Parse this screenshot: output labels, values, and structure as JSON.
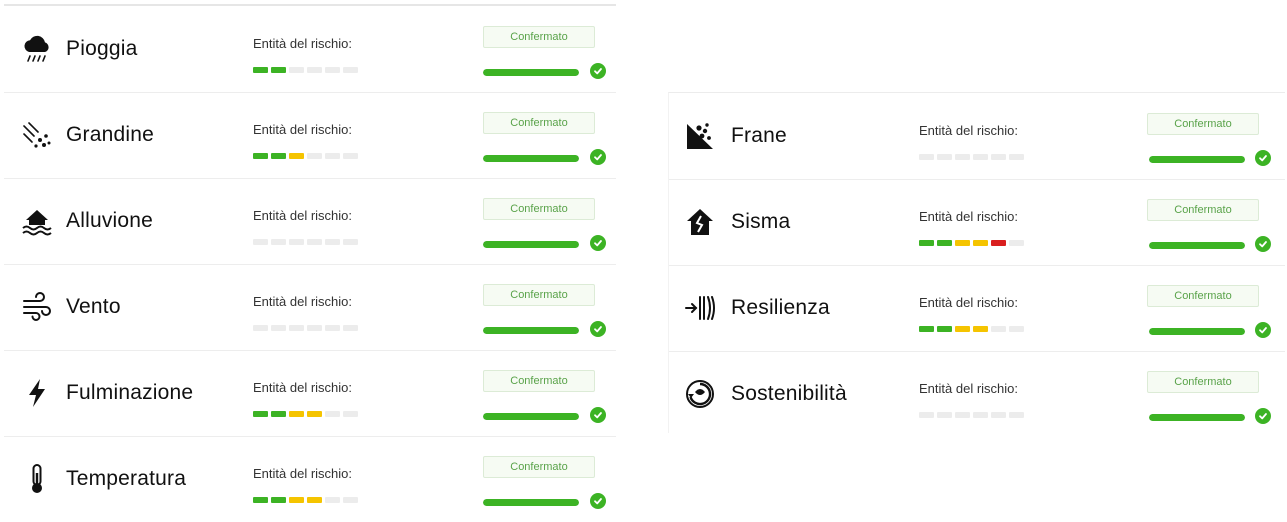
{
  "colors": {
    "accent_green": "#3cb324",
    "meter_yellow": "#f5c400",
    "meter_red": "#d91f1f",
    "meter_empty": "#ececec"
  },
  "risk_label": "Entità del rischio:",
  "confirm_label": "Confermato",
  "meter_total_segments": 6,
  "panels": [
    {
      "name": "left",
      "rows": [
        {
          "name": "Pioggia",
          "icon": "rain-cloud-icon",
          "levels": [
            "green",
            "green"
          ],
          "progress": 1.0
        },
        {
          "name": "Grandine",
          "icon": "hail-icon",
          "levels": [
            "green",
            "green",
            "yellow"
          ],
          "progress": 1.0
        },
        {
          "name": "Alluvione",
          "icon": "flood-house-icon",
          "levels": [],
          "progress": 1.0
        },
        {
          "name": "Vento",
          "icon": "wind-icon",
          "levels": [],
          "progress": 1.0
        },
        {
          "name": "Fulminazione",
          "icon": "lightning-bolt-icon",
          "levels": [
            "green",
            "green",
            "yellow",
            "yellow"
          ],
          "progress": 1.0
        },
        {
          "name": "Temperatura",
          "icon": "thermometer-icon",
          "levels": [
            "green",
            "green",
            "yellow",
            "yellow"
          ],
          "progress": 1.0
        }
      ]
    },
    {
      "name": "right",
      "rows": [
        {
          "name": "Frane",
          "icon": "landslide-icon",
          "levels": [],
          "progress": 1.0
        },
        {
          "name": "Sisma",
          "icon": "earthquake-house-icon",
          "levels": [
            "green",
            "green",
            "yellow",
            "yellow",
            "red"
          ],
          "progress": 1.0
        },
        {
          "name": "Resilienza",
          "icon": "resilience-icon",
          "levels": [
            "green",
            "green",
            "yellow",
            "yellow"
          ],
          "progress": 1.0
        },
        {
          "name": "Sostenibilità",
          "icon": "sustainability-icon",
          "levels": [],
          "progress": 1.0
        }
      ]
    }
  ]
}
